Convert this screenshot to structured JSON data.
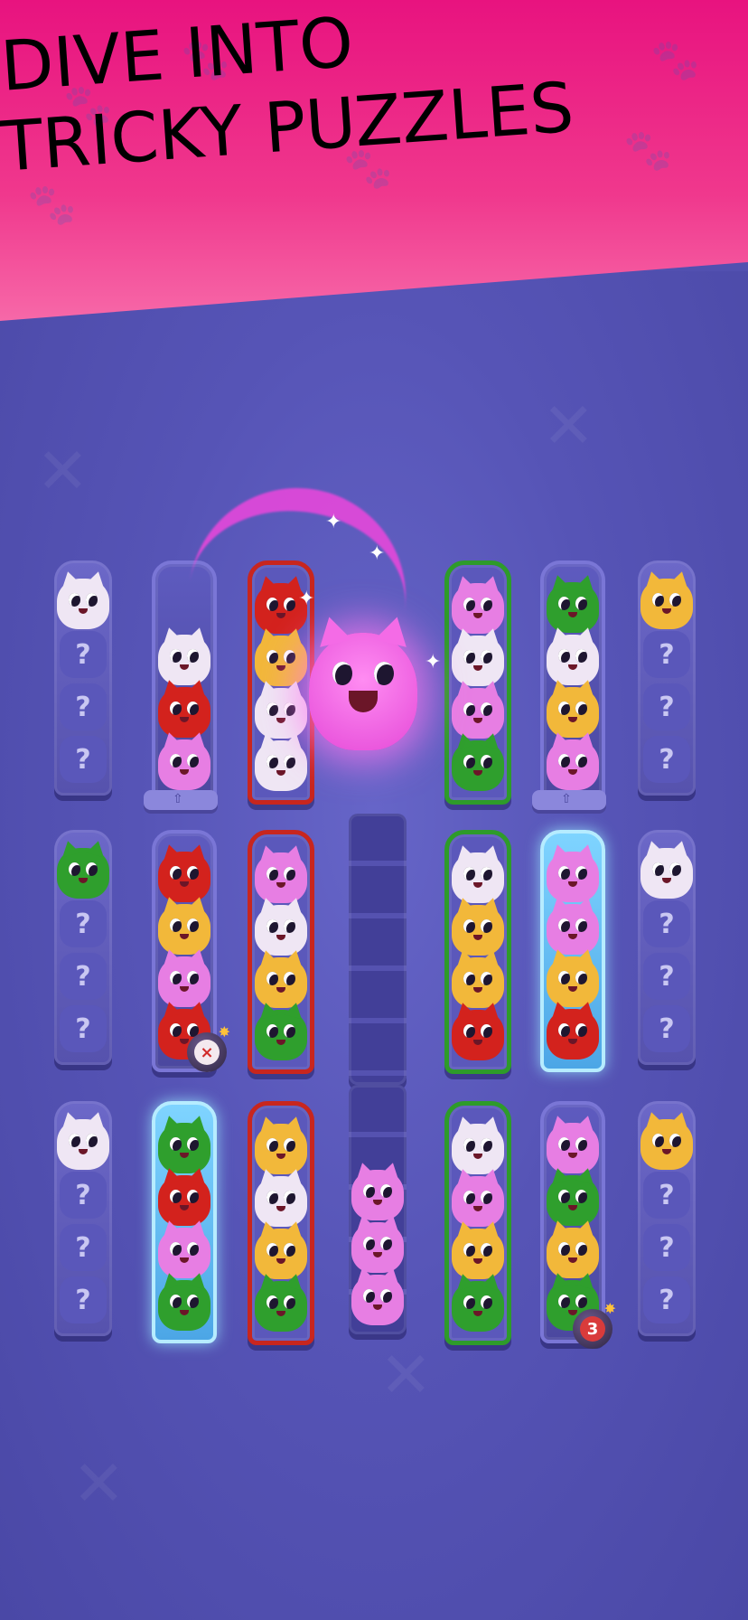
{
  "headline": {
    "line1": "DIVE INTO",
    "line2": "TRICKY PUZZLES"
  },
  "colors": {
    "banner": "#e8137f",
    "board": "#5250b0",
    "red": "#d3221d",
    "yellow": "#f2b83a",
    "pink": "#e77ee3",
    "green": "#2f9f2d",
    "white": "#efe6f4"
  },
  "symbols": {
    "mystery": "?",
    "bomb_disarmed": "×",
    "bomb_countdown": "3"
  },
  "rows": [
    {
      "tubes": [
        {
          "type": "mystery",
          "cats": [
            "white"
          ],
          "hidden": 3
        },
        {
          "type": "plain",
          "cats": [
            "white",
            "red",
            "pink"
          ],
          "hidden": 0,
          "stand": true
        },
        {
          "type": "red-done",
          "cats": [
            "red",
            "yellow",
            "white",
            "white"
          ],
          "hidden": 0
        },
        {
          "type": "hero",
          "cats": [],
          "hidden": 0
        },
        {
          "type": "green-done",
          "cats": [
            "pink",
            "white",
            "pink",
            "green"
          ],
          "hidden": 0
        },
        {
          "type": "plain",
          "cats": [
            "green",
            "white",
            "yellow",
            "pink"
          ],
          "hidden": 0,
          "stand": true
        },
        {
          "type": "mystery",
          "cats": [
            "yellow"
          ],
          "hidden": 3
        }
      ]
    },
    {
      "tubes": [
        {
          "type": "mystery",
          "cats": [
            "green"
          ],
          "hidden": 3
        },
        {
          "type": "plain",
          "cats": [
            "red",
            "yellow",
            "pink",
            "red"
          ],
          "hidden": 0,
          "bomb": "x"
        },
        {
          "type": "red-done",
          "cats": [
            "pink",
            "white",
            "yellow",
            "green"
          ],
          "hidden": 0
        },
        {
          "type": "column",
          "cats": [],
          "hidden": 0
        },
        {
          "type": "green-done",
          "cats": [
            "white",
            "yellow",
            "yellow",
            "red"
          ],
          "hidden": 0
        },
        {
          "type": "frozen",
          "cats": [
            "pink",
            "pink",
            "yellow",
            "red"
          ],
          "hidden": 0
        },
        {
          "type": "mystery",
          "cats": [
            "white"
          ],
          "hidden": 3
        }
      ]
    },
    {
      "tubes": [
        {
          "type": "mystery",
          "cats": [
            "white"
          ],
          "hidden": 3
        },
        {
          "type": "frozen",
          "cats": [
            "green",
            "red",
            "pink",
            "green"
          ],
          "hidden": 0
        },
        {
          "type": "red-done",
          "cats": [
            "yellow",
            "white",
            "yellow",
            "green"
          ],
          "hidden": 0
        },
        {
          "type": "column",
          "cats": [
            "pink",
            "pink",
            "pink"
          ],
          "hidden": 0
        },
        {
          "type": "green-done",
          "cats": [
            "white",
            "pink",
            "yellow",
            "green"
          ],
          "hidden": 0
        },
        {
          "type": "plain",
          "cats": [
            "pink",
            "green",
            "yellow",
            "green"
          ],
          "hidden": 0,
          "bomb": "3"
        },
        {
          "type": "mystery",
          "cats": [
            "yellow"
          ],
          "hidden": 3
        }
      ]
    }
  ]
}
